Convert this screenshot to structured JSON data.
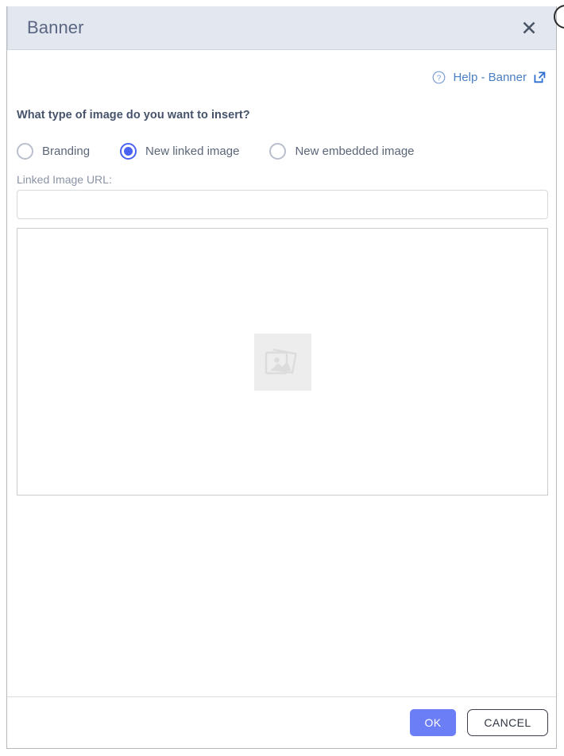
{
  "dialog": {
    "title": "Banner",
    "close_icon": "close-x-icon",
    "corner_icon": "circle-outline-icon"
  },
  "help": {
    "icon": "question-circle-icon",
    "label": "Help - Banner",
    "external_icon": "external-link-icon"
  },
  "form": {
    "question": "What type of image do you want to insert?",
    "options": [
      {
        "label": "Branding",
        "selected": false
      },
      {
        "label": "New linked image",
        "selected": true
      },
      {
        "label": "New embedded image",
        "selected": false
      }
    ],
    "url_field": {
      "label": "Linked Image URL:",
      "value": "",
      "placeholder": ""
    },
    "preview": {
      "icon": "broken-image-icon"
    }
  },
  "footer": {
    "ok_label": "OK",
    "cancel_label": "CANCEL"
  },
  "colors": {
    "header_bg": "#e3e7f0",
    "accent_blue": "#4a63f0",
    "ok_button": "#6b7ef5",
    "help_link": "#4a7ec4"
  }
}
